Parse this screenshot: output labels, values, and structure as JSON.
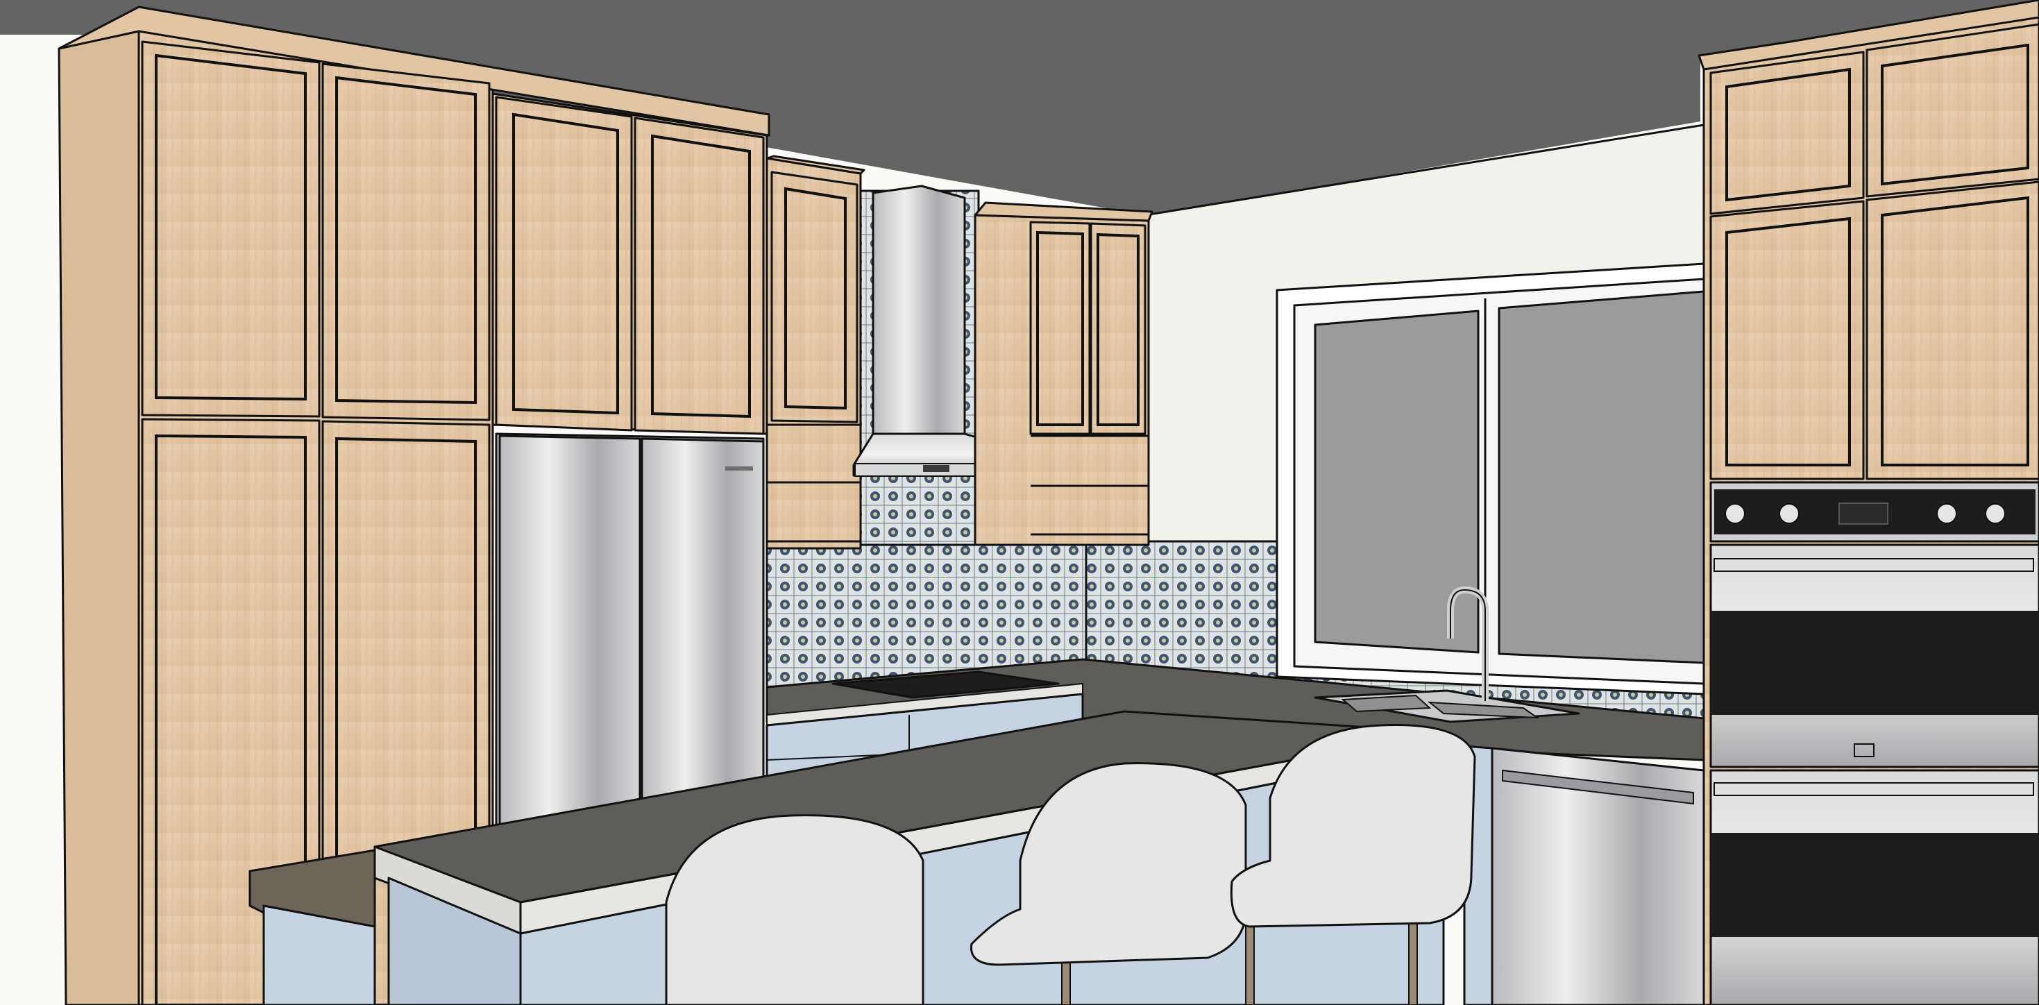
{
  "scene": {
    "colors": {
      "ceiling": "#646464",
      "wall": "#f2f1ec",
      "wood": "#e4c8a8",
      "wood_dark": "#d2b08c",
      "steel": "#c9cacc",
      "steel_dark": "#9a9b9e",
      "lower_cabinet": "#c6d3e3",
      "counter": "#5f5d5a",
      "counter_edge": "#e8e6e2",
      "tile_a": "#3e5670",
      "tile_b": "#dfe3e4",
      "glass": "#9b9b9b",
      "chair": "#e6e6e6",
      "oven_black": "#1d1d1d"
    },
    "icons": [
      "range-hood-icon",
      "faucet-icon",
      "oven-knob-icon"
    ]
  }
}
